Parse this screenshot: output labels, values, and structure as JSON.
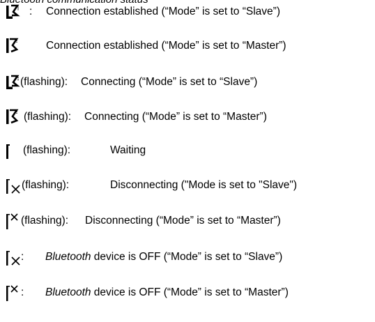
{
  "heading": "Bluetooth communication status",
  "rows": [
    {
      "icon": "bluetooth-slave-connected-icon",
      "label": ":",
      "text": "Connection established (“Mode” is set to “Slave”)"
    },
    {
      "icon": "bluetooth-master-connected-icon",
      "label": "",
      "text": "Connection established (“Mode” is set to “Master”)"
    },
    {
      "icon": "bluetooth-slave-connected-icon",
      "label": "(flashing):",
      "text": "Connecting (“Mode” is set to “Slave”)"
    },
    {
      "icon": "bluetooth-master-connected-icon",
      "label": "(flashing):",
      "text": "Connecting (“Mode” is set to “Master”)"
    },
    {
      "icon": "bluetooth-waiting-icon",
      "label": "(flashing):",
      "text": "Waiting"
    },
    {
      "icon": "bluetooth-slave-disconnect-icon",
      "label": "(flashing):",
      "text": "Disconnecting (\"Mode is set to \"Slave\")"
    },
    {
      "icon": "bluetooth-master-disconnect-icon",
      "label": "(flashing):",
      "text": "Disconnecting (“Mode” is set to “Master”)"
    },
    {
      "icon": "bluetooth-slave-off-icon",
      "label": ":",
      "text_em": "Bluetooth",
      "text": " device is OFF (“Mode” is set to “Slave”)"
    },
    {
      "icon": "bluetooth-master-off-icon",
      "label": ":",
      "text_em": "Bluetooth",
      "text": " device is OFF (“Mode” is set to “Master”)"
    }
  ]
}
